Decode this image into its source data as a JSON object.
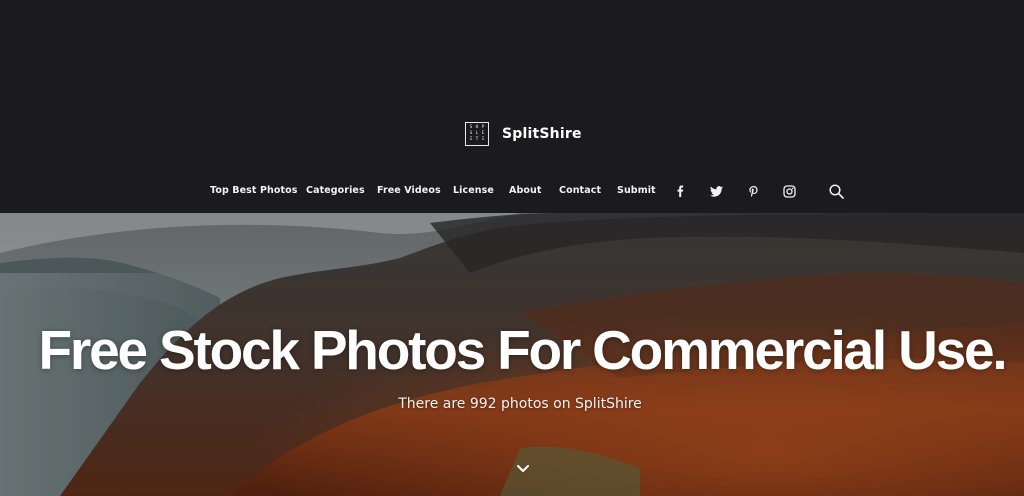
{
  "brand": {
    "name": "SplitShire",
    "logo_letters": [
      "S",
      "H",
      "P",
      "S",
      "L",
      "E",
      "I",
      "T",
      "I"
    ]
  },
  "nav": {
    "items": [
      "Top Best Photos",
      "Categories",
      "Free Videos",
      "License",
      "About",
      "Contact",
      "Submit"
    ],
    "social_icons": [
      "facebook-icon",
      "twitter-icon",
      "pinterest-icon",
      "instagram-icon"
    ],
    "search_icon": "search-icon"
  },
  "hero": {
    "headline": "Free Stock Photos For Commercial Use.",
    "subline": "There are 992 photos on SplitShire",
    "scroll_icon": "chevron-down-icon"
  },
  "colors": {
    "header_bg": "#1b1b1d",
    "text": "#ffffff",
    "forest_orange": "#a3461e",
    "mist": "#8a9395"
  }
}
